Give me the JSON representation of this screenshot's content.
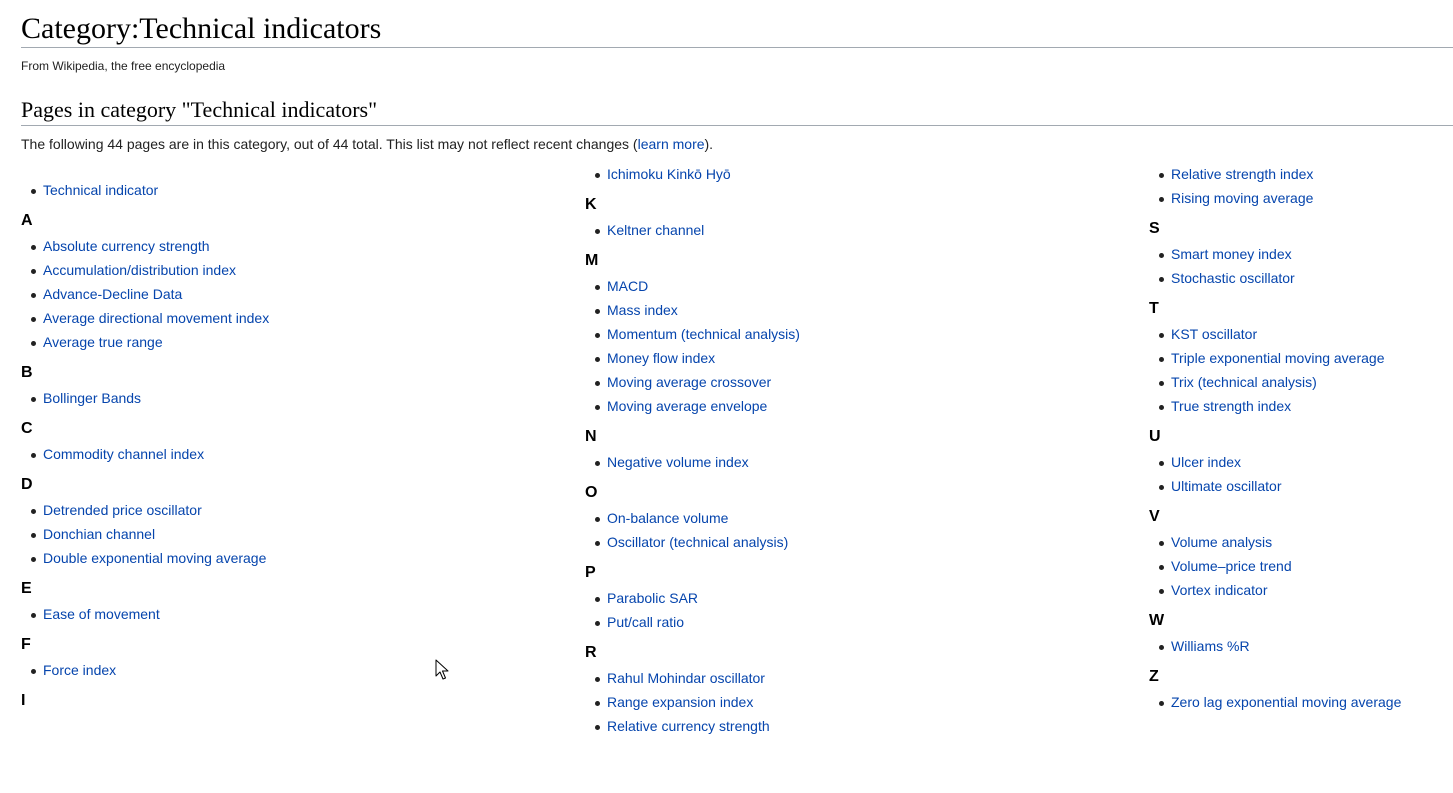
{
  "page": {
    "title": "Category:Technical indicators",
    "tagline": "From Wikipedia, the free encyclopedia"
  },
  "section": {
    "heading": "Pages in category \"Technical indicators\"",
    "summary_before": "The following 44 pages are in this category, out of 44 total. This list may not reflect recent changes (",
    "summary_link": "learn more",
    "summary_after": ")."
  },
  "columns": {
    "col1": {
      "top_item": "Technical indicator",
      "groups": [
        {
          "letter": "A",
          "items": [
            "Absolute currency strength",
            "Accumulation/distribution index",
            "Advance-Decline Data",
            "Average directional movement index",
            "Average true range"
          ]
        },
        {
          "letter": "B",
          "items": [
            "Bollinger Bands"
          ]
        },
        {
          "letter": "C",
          "items": [
            "Commodity channel index"
          ]
        },
        {
          "letter": "D",
          "items": [
            "Detrended price oscillator",
            "Donchian channel",
            "Double exponential moving average"
          ]
        },
        {
          "letter": "E",
          "items": [
            "Ease of movement"
          ]
        },
        {
          "letter": "F",
          "items": [
            "Force index"
          ]
        },
        {
          "letter": "I",
          "items": []
        }
      ]
    },
    "col2": {
      "top_item": "Ichimoku Kinkō Hyō",
      "groups": [
        {
          "letter": "K",
          "items": [
            "Keltner channel"
          ]
        },
        {
          "letter": "M",
          "items": [
            "MACD",
            "Mass index",
            "Momentum (technical analysis)",
            "Money flow index",
            "Moving average crossover",
            "Moving average envelope"
          ]
        },
        {
          "letter": "N",
          "items": [
            "Negative volume index"
          ]
        },
        {
          "letter": "O",
          "items": [
            "On-balance volume",
            "Oscillator (technical analysis)"
          ]
        },
        {
          "letter": "P",
          "items": [
            "Parabolic SAR",
            "Put/call ratio"
          ]
        },
        {
          "letter": "R",
          "items": [
            "Rahul Mohindar oscillator",
            "Range expansion index",
            "Relative currency strength"
          ]
        }
      ]
    },
    "col3": {
      "top_items": [
        "Relative strength index",
        "Rising moving average"
      ],
      "groups": [
        {
          "letter": "S",
          "items": [
            "Smart money index",
            "Stochastic oscillator"
          ]
        },
        {
          "letter": "T",
          "items": [
            "KST oscillator",
            "Triple exponential moving average",
            "Trix (technical analysis)",
            "True strength index"
          ]
        },
        {
          "letter": "U",
          "items": [
            "Ulcer index",
            "Ultimate oscillator"
          ]
        },
        {
          "letter": "V",
          "items": [
            "Volume analysis",
            "Volume–price trend",
            "Vortex indicator"
          ]
        },
        {
          "letter": "W",
          "items": [
            "Williams %R"
          ]
        },
        {
          "letter": "Z",
          "items": [
            "Zero lag exponential moving average"
          ]
        }
      ]
    }
  },
  "colors": {
    "link": "#0645ad",
    "text": "#222222",
    "rule": "#a2a9b1"
  },
  "icons": {
    "cursor": "mouse-pointer-icon"
  }
}
